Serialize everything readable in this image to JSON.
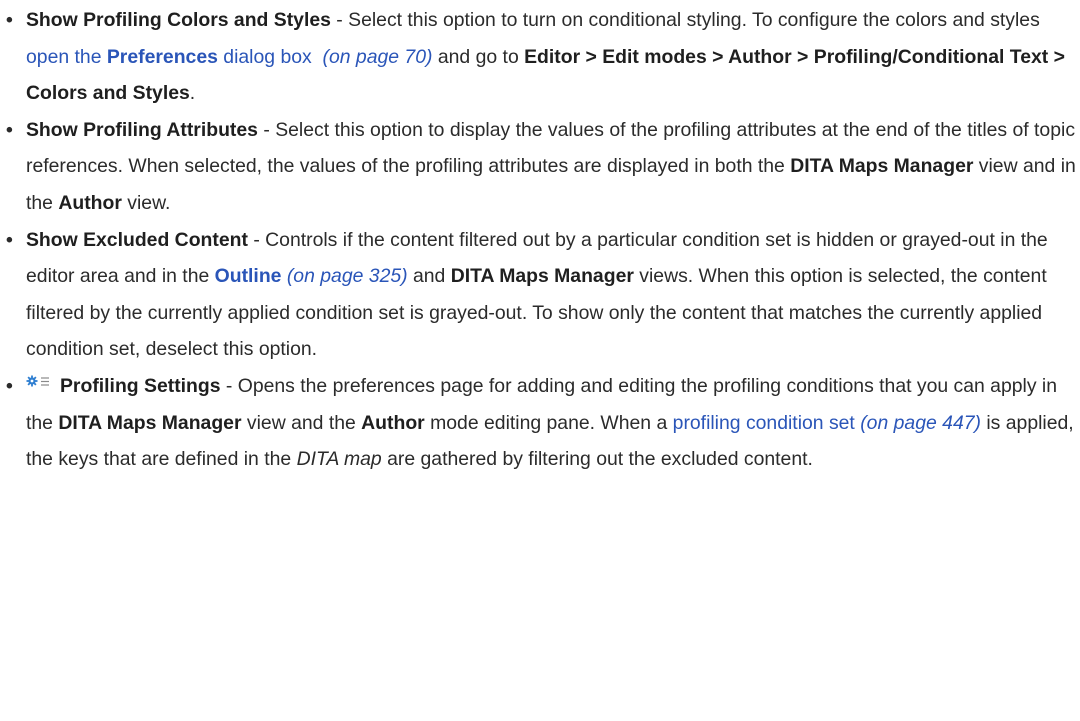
{
  "items": [
    {
      "title": "Show Profiling Colors and Styles",
      "desc_1": " - Select this option to turn on conditional styling. To configure the colors and styles ",
      "link_open": "open the ",
      "link_bold": "Preferences",
      "link_tail": " dialog box",
      "pageref": "(on page 70)",
      "desc_2": " and go to ",
      "path": "Editor > Edit modes > Author > Profiling/Conditional Text > Colors and Styles",
      "end": "."
    },
    {
      "title": "Show Profiling Attributes",
      "desc_1": " - Select this option to display the values of the profiling attributes at the end of the titles of topic references. When selected, the values of the profiling attributes are displayed in both the ",
      "bold_1": "DITA Maps Manager",
      "desc_2": " view and in the ",
      "bold_2": "Author",
      "desc_3": " view."
    },
    {
      "title": "Show Excluded Content",
      "desc_1": " - Controls if the content filtered out by a particular condition set is hidden or grayed-out in the editor area and in the ",
      "link_bold": "Outline",
      "pageref": "(on page 325)",
      "desc_2": " and ",
      "bold_1": "DITA Maps Manager",
      "desc_3": " views. When this option is selected, the content filtered by the currently applied condition set is grayed-out. To show only the content that matches the currently applied condition set, deselect this option."
    },
    {
      "icon": "profiling-settings-icon",
      "title": "Profiling Settings",
      "desc_1": " - Opens the preferences page for adding and editing the profiling conditions that you can apply in the ",
      "bold_1": "DITA Maps Manager",
      "desc_2": " view and the ",
      "bold_2": "Author",
      "desc_3": " mode editing pane. When a ",
      "link": "profiling condition set",
      "pageref": "(on page 447)",
      "desc_4": " is applied, the keys that are defined in the ",
      "term": "DITA map",
      "desc_5": " are gathered by filtering out the excluded content."
    }
  ],
  "bullet": "•",
  "colors": {
    "text": "#2b2b2b",
    "link": "#2a55b8",
    "icon_blue": "#2f7fd1"
  }
}
